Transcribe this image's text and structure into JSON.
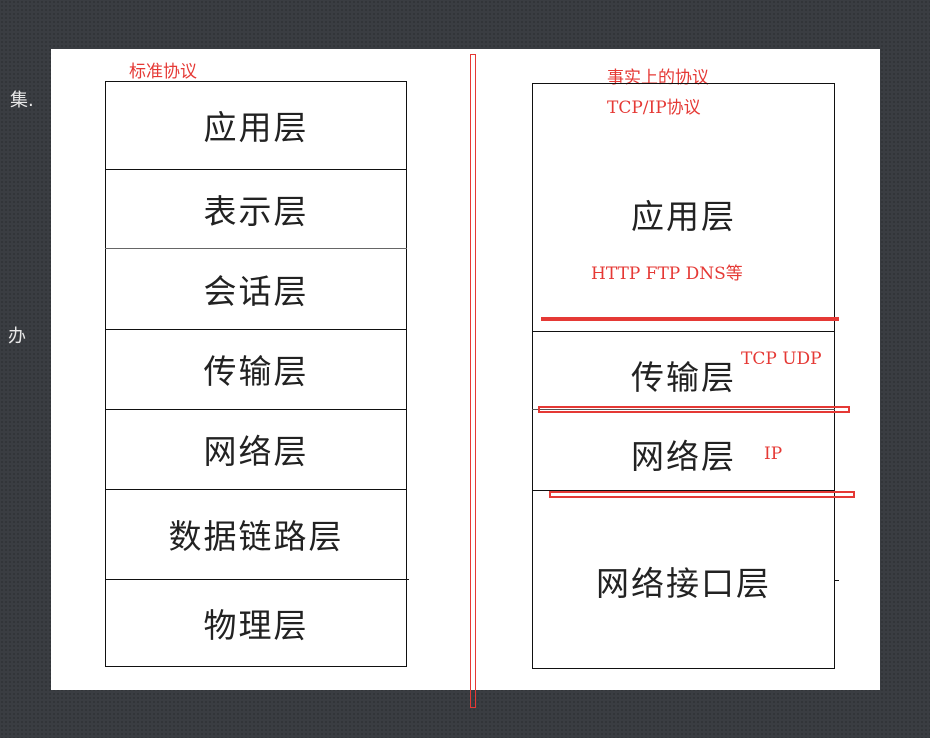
{
  "background_fragments": [
    "集.",
    "办"
  ],
  "left_stack": {
    "title": "标准协议",
    "layers": [
      "应用层",
      "表示层",
      "会话层",
      "传输层",
      "网络层",
      "数据链路层",
      "物理层"
    ]
  },
  "right_stack": {
    "title": "事实上的协议",
    "subtitle": "TCP/IP协议",
    "layers": [
      "应用层",
      "传输层",
      "网络层",
      "网络接口层"
    ],
    "annotations": {
      "application": "HTTP FTP DNS等",
      "transport": "TCP UDP",
      "network": "IP"
    }
  },
  "colors": {
    "accent": "#e53935",
    "panel": "#ffffff",
    "slide_background": "#3a3d42"
  }
}
